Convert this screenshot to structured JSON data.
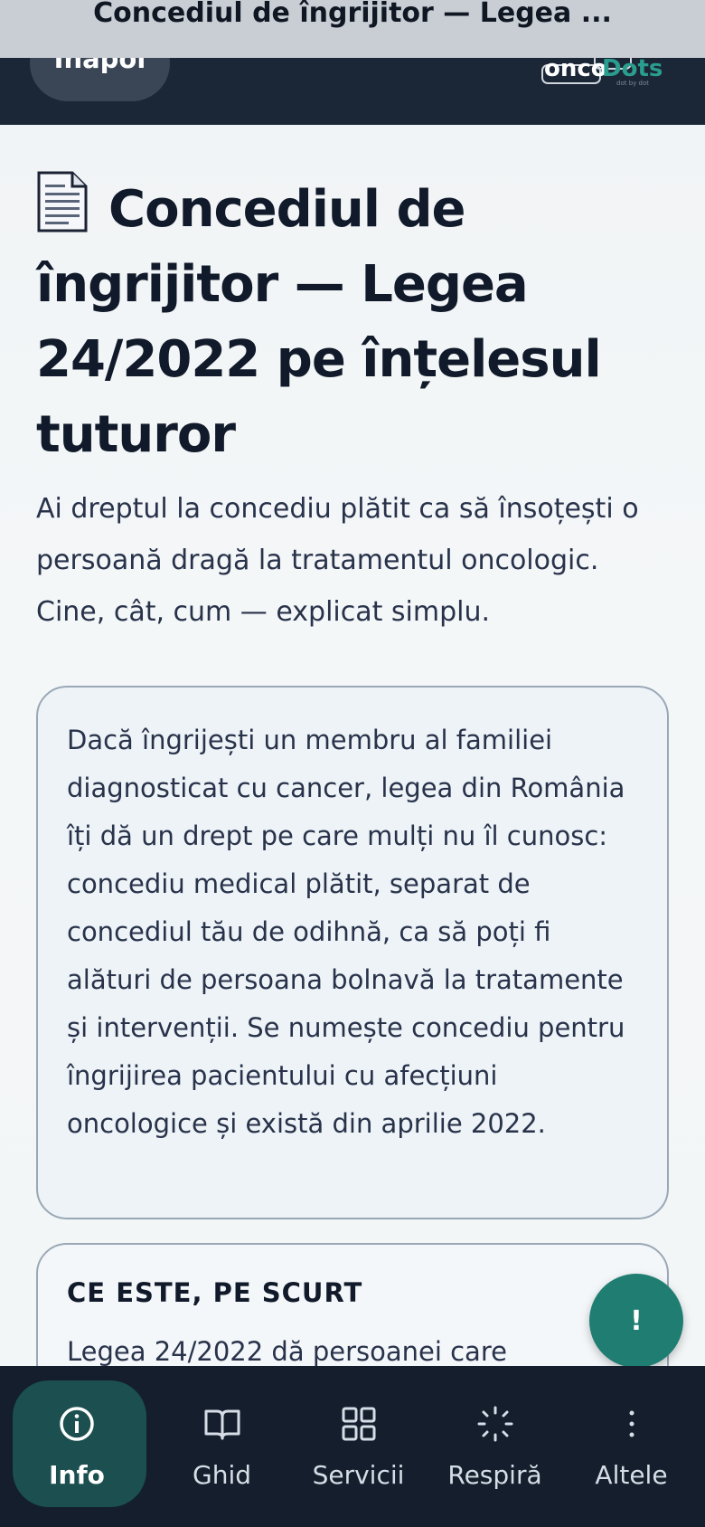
{
  "header": {
    "window_title": "Concediul de îngrijitor — Legea ...",
    "back_label": "Înapoi",
    "logo": {
      "text_onco": "onco",
      "text_dots": "Dots",
      "tagline": "dot by dot"
    }
  },
  "article": {
    "title": "Concediul de îngrijitor — Legea 24/2022 pe înțelesul tuturor",
    "lead": "Ai dreptul la concediu plătit ca să însoțești o persoană dragă la tratamentul oncologic. Cine, cât, cum — explicat simplu.",
    "intro": "Dacă îngrijești un membru al familiei diagnosticat cu cancer, legea din România îți dă un drept pe care mulți nu îl cunosc: concediu medical plătit, separat de concediul tău de odihnă, ca să poți fi alături de persoana bolnavă la tratamente și intervenții. Se numește concediu pentru îngrijirea pacientului cu afecțiuni oncologice și există din aprilie 2022.",
    "summary_heading": "CE ESTE, PE SCURT",
    "summary_text": "Legea 24/2022 dă persoanei care"
  },
  "fab": {
    "label": "!"
  },
  "nav": [
    {
      "label": "Info",
      "icon": "info-icon",
      "active": true
    },
    {
      "label": "Ghid",
      "icon": "book-icon",
      "active": false
    },
    {
      "label": "Servicii",
      "icon": "grid-icon",
      "active": false
    },
    {
      "label": "Respiră",
      "icon": "breathe-icon",
      "active": false
    },
    {
      "label": "Altele",
      "icon": "more-icon",
      "active": false
    }
  ],
  "colors": {
    "header_bg": "#1b2636",
    "accent": "#1f7d72",
    "nav_bg": "#141e2d",
    "nav_active": "#1c4f50"
  }
}
